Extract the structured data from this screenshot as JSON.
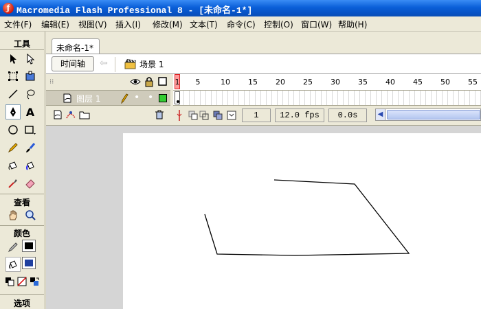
{
  "window": {
    "title": "Macromedia Flash Professional 8 - [未命名-1*]"
  },
  "menu": [
    {
      "label": "文件(F)"
    },
    {
      "label": "编辑(E)"
    },
    {
      "label": "视图(V)"
    },
    {
      "label": "插入(I)"
    },
    {
      "label": "修改(M)"
    },
    {
      "label": "文本(T)"
    },
    {
      "label": "命令(C)"
    },
    {
      "label": "控制(O)"
    },
    {
      "label": "窗口(W)"
    },
    {
      "label": "帮助(H)"
    }
  ],
  "toolbox": {
    "tools_heading": "工具",
    "view_heading": "查看",
    "colors_heading": "颜色",
    "options_heading": "选项",
    "selected_tool": "pen",
    "stroke_color": "#000000",
    "fill_color": "#1f3f9f"
  },
  "document": {
    "tab_label": "未命名-1*",
    "timeline_button": "时间轴",
    "scene_label": "场景 1"
  },
  "timeline": {
    "ruler_numbers": [
      "1",
      "5",
      "10",
      "15",
      "20",
      "25",
      "30",
      "35",
      "40",
      "45",
      "50",
      "55"
    ],
    "layer_name": "图层 1",
    "current_frame": "1",
    "frame_rate": "12.0 fps",
    "elapsed_time": "0.0s",
    "layer_outline_color": "#33cc33"
  }
}
